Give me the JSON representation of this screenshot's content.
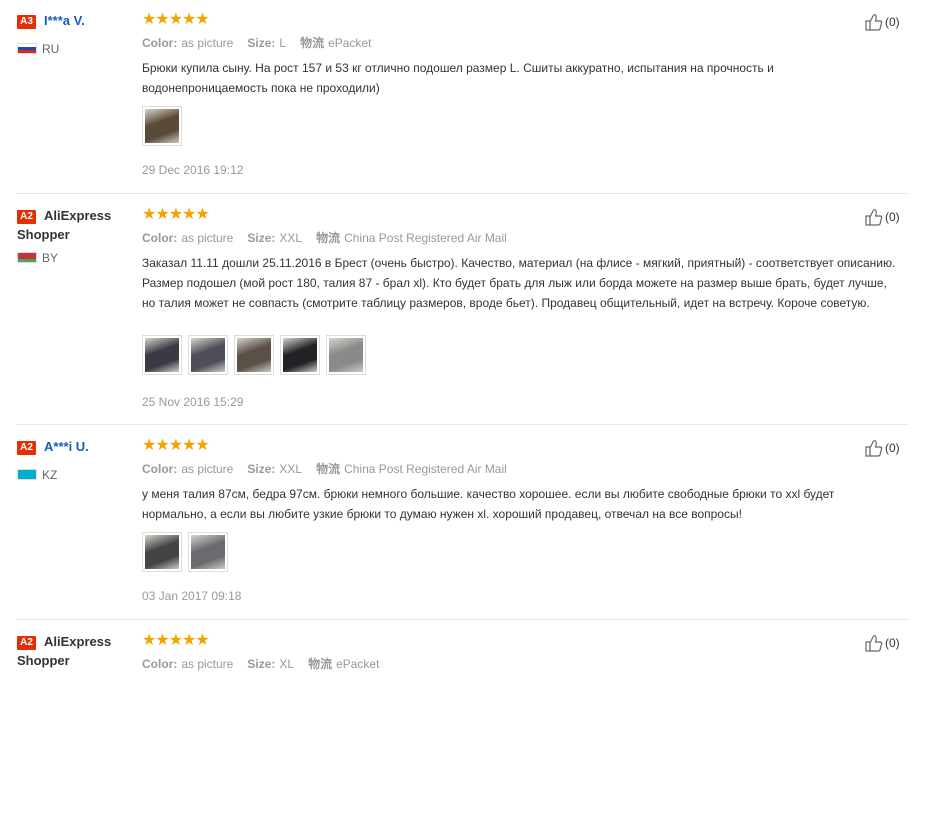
{
  "labels": {
    "color": "Color:",
    "size": "Size:",
    "shipping": "物流"
  },
  "reviews": [
    {
      "badge": "A3",
      "name": "I***a V.",
      "name2": "",
      "country": "RU",
      "flag": [
        "#ffffff",
        "#1f4ab5",
        "#d52b1e"
      ],
      "color": "as picture",
      "size": "L",
      "shipping": "ePacket",
      "text": "Брюки купила сыну. На рост 157 и 53 кг отлично подошел размер L. Сшиты аккуратно, испытания на прочность и водонепроницаемость пока не проходили)",
      "thumbs": [
        "#5a4a38"
      ],
      "date": "29 Dec 2016 19:12",
      "likes": "(0)"
    },
    {
      "badge": "A2",
      "name": "AliExpress",
      "name2": "Shopper",
      "country": "BY",
      "flag": [
        "#c8313e",
        "#c8313e",
        "#4aa657"
      ],
      "color": "as picture",
      "size": "XXL",
      "shipping": "China Post Registered Air Mail",
      "text": "Заказал 11.11 дошли 25.11.2016 в Брест (очень быстро). Качество, материал (на флисе - мягкий, приятный) - соответствует описанию. Размер подошел (мой рост 180, талия 87 - брал xl). Кто будет брать для лыж или борда можете на размер выше брать, будет лучше, но талия может не совпасть (смотрите таблицу размеров, вроде бьет). Продавец общительный, идет на встречу. Короче советую.",
      "thumbs": [
        "#3a3a44",
        "#4e4e58",
        "#5a5048",
        "#222226",
        "#8a8a8a"
      ],
      "date": "25 Nov 2016 15:29",
      "likes": "(0)"
    },
    {
      "badge": "A2",
      "name": "A***i U.",
      "name2": "",
      "country": "KZ",
      "flag": [
        "#00afca",
        "#00afca",
        "#00afca"
      ],
      "color": "as picture",
      "size": "XXL",
      "shipping": "China Post Registered Air Mail",
      "text": "у меня талия 87см, бедра 97см. брюки немного большие. качество хорошее. если вы любите свободные брюки то xxl будет нормально, а если вы любите узкие брюки то думаю нужен xl. хороший продавец, отвечал на все вопросы!",
      "thumbs": [
        "#444444",
        "#6a6a70"
      ],
      "date": "03 Jan 2017 09:18",
      "likes": "(0)"
    },
    {
      "badge": "A2",
      "name": "AliExpress",
      "name2": "Shopper",
      "country": "",
      "flag": [],
      "color": "as picture",
      "size": "XL",
      "shipping": "ePacket",
      "text": "",
      "thumbs": [],
      "date": "",
      "likes": "(0)"
    }
  ]
}
